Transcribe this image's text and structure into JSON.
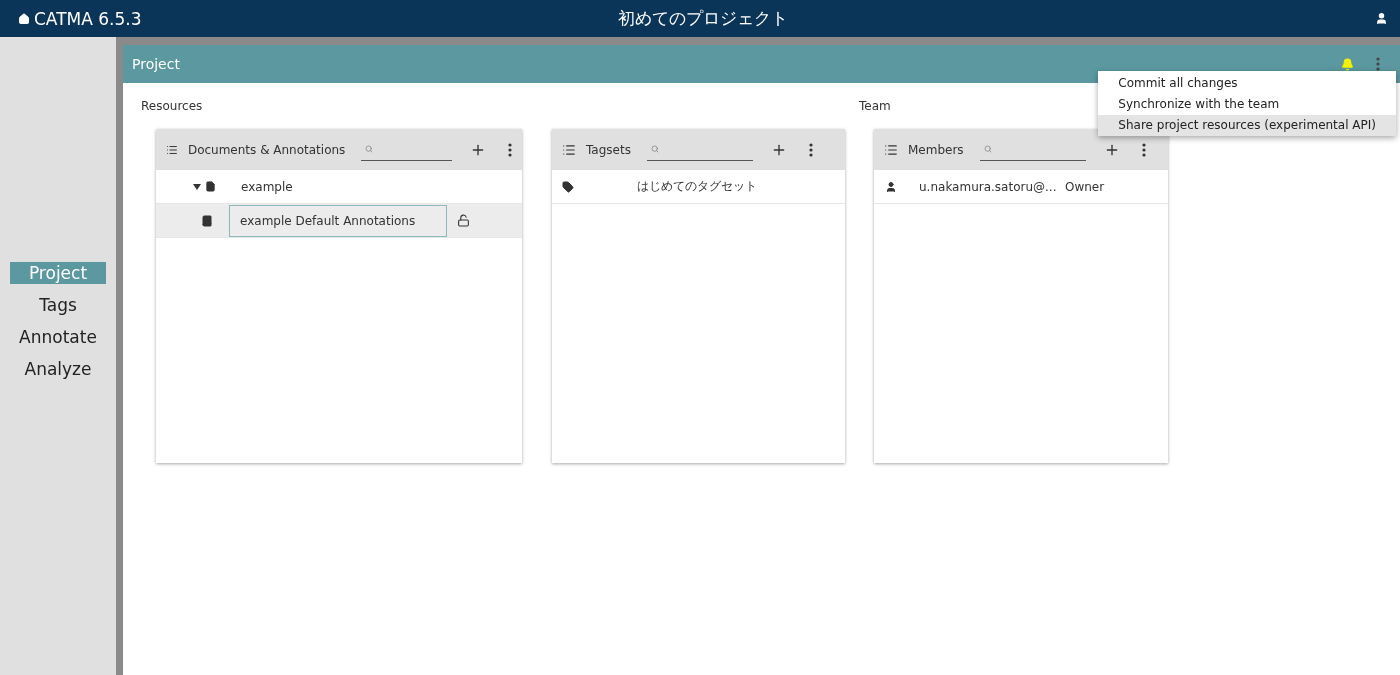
{
  "app": {
    "name": "CATMA 6.5.3",
    "project_title": "初めてのプロジェクト"
  },
  "sidebar": {
    "items": [
      {
        "label": "Project",
        "selected": true
      },
      {
        "label": "Tags",
        "selected": false
      },
      {
        "label": "Annotate",
        "selected": false
      },
      {
        "label": "Analyze",
        "selected": false
      }
    ]
  },
  "panel": {
    "title": "Project"
  },
  "menu": {
    "items": [
      {
        "label": "Commit all changes",
        "selected": false
      },
      {
        "label": "Synchronize with the team",
        "selected": false
      },
      {
        "label": "Share project resources (experimental API)",
        "selected": true
      }
    ]
  },
  "sections": [
    {
      "label": "Resources"
    },
    {
      "label": "Team"
    }
  ],
  "documents": {
    "title": "Documents & Annotations",
    "rows": [
      {
        "kind": "document",
        "label": "example",
        "expanded": true,
        "selected": false
      },
      {
        "kind": "collection",
        "label": "example Default Annotations",
        "selected": true
      }
    ]
  },
  "tagsets": {
    "title": "Tagsets",
    "rows": [
      {
        "label": "はじめてのタグセット"
      }
    ]
  },
  "members": {
    "title": "Members",
    "rows": [
      {
        "name": "u.nakamura.satoru@...",
        "role": "Owner"
      }
    ]
  }
}
